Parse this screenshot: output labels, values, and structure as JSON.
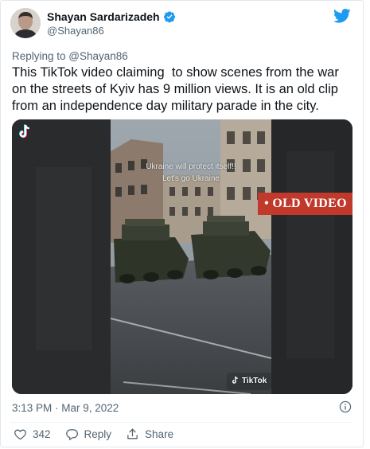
{
  "author": {
    "name": "Shayan Sardarizadeh",
    "handle": "@Shayan86",
    "verified": true
  },
  "reply_to": "Replying to @Shayan86",
  "tweet_text": "This TikTok video claiming  to show scenes from the war on the streets of Kyiv has 9 million views. It is an old clip from an independence day military parade in the city.",
  "media": {
    "overlay_caption": "Ukraine will protect itself!!\nLet's go Ukraine",
    "badge": "• OLD VIDEO",
    "watermark": "TikTok"
  },
  "timestamp": "3:13 PM · Mar 9, 2022",
  "actions": {
    "likes": "342",
    "reply_label": "Reply",
    "share_label": "Share"
  },
  "colors": {
    "brand": "#1d9bf0",
    "text": "#0f1419",
    "muted": "#536471",
    "badge": "#c0392b"
  },
  "icons": [
    "twitter-bird-icon",
    "verified-badge-icon",
    "tiktok-logo-icon",
    "info-icon",
    "heart-icon",
    "reply-icon",
    "share-icon"
  ]
}
